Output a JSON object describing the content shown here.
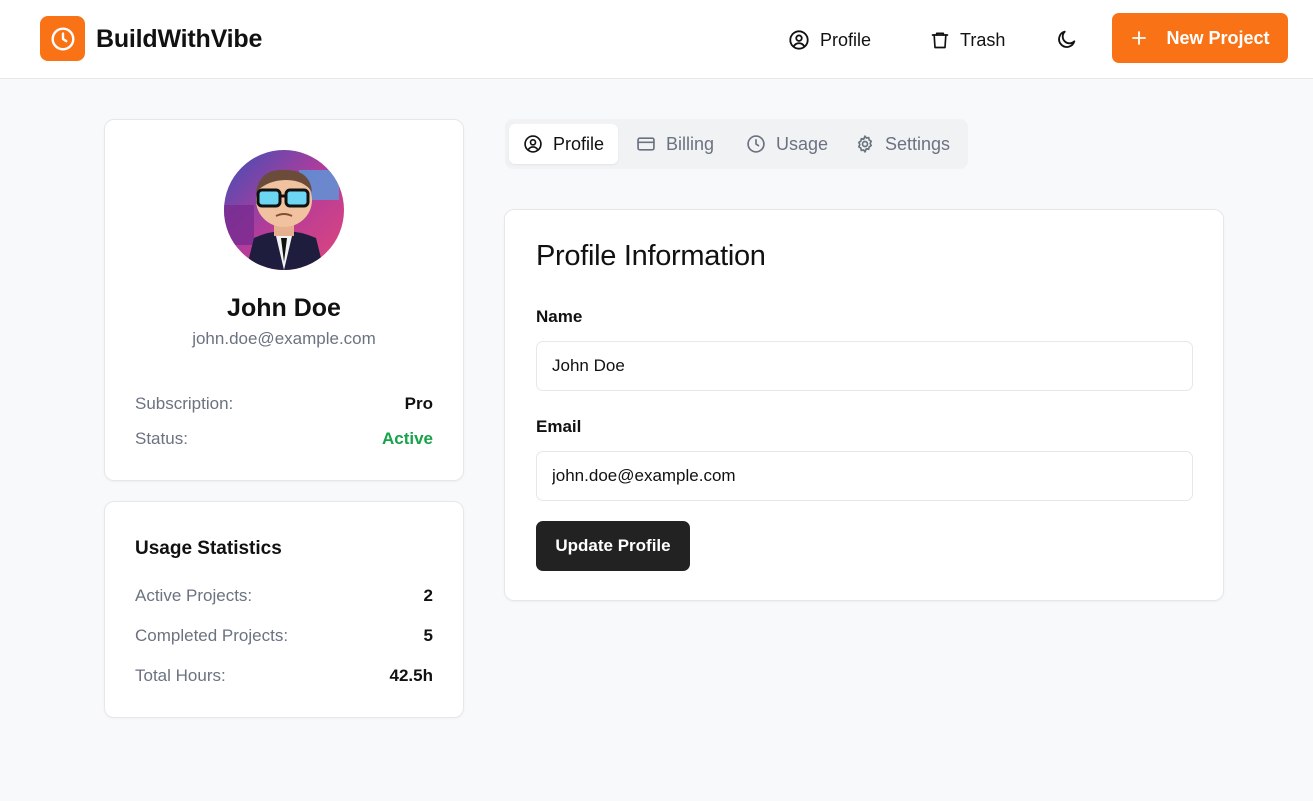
{
  "header": {
    "brand": "BuildWithVibe",
    "nav": {
      "profile_label": "Profile",
      "trash_label": "Trash"
    },
    "new_project_label": "New Project",
    "accent_color": "#f97316"
  },
  "profile_card": {
    "name": "John Doe",
    "email": "john.doe@example.com",
    "subscription_label": "Subscription:",
    "subscription_value": "Pro",
    "status_label": "Status:",
    "status_value": "Active",
    "status_color": "#16a34a"
  },
  "usage": {
    "title": "Usage Statistics",
    "active_projects_label": "Active Projects:",
    "active_projects_value": "2",
    "completed_projects_label": "Completed Projects:",
    "completed_projects_value": "5",
    "total_hours_label": "Total Hours:",
    "total_hours_value": "42.5h"
  },
  "tabs": [
    {
      "label": "Profile",
      "icon": "user-circle-icon",
      "active": true
    },
    {
      "label": "Billing",
      "icon": "credit-card-icon",
      "active": false
    },
    {
      "label": "Usage",
      "icon": "clock-icon",
      "active": false
    },
    {
      "label": "Settings",
      "icon": "gear-icon",
      "active": false
    }
  ],
  "profile_form": {
    "title": "Profile Information",
    "name_label": "Name",
    "name_value": "John Doe",
    "email_label": "Email",
    "email_value": "john.doe@example.com",
    "submit_label": "Update Profile"
  },
  "icons": {
    "logo": "clock-icon",
    "nav_profile": "user-circle-icon",
    "nav_trash": "trash-icon",
    "theme": "moon-icon",
    "new_project": "plus-icon"
  }
}
